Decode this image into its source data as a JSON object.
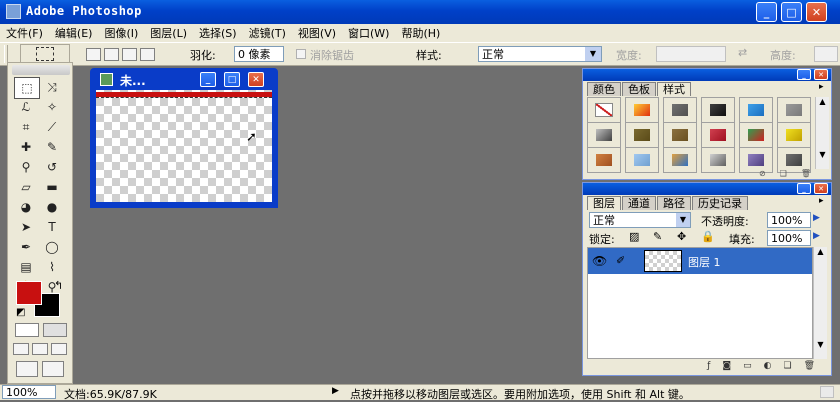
{
  "app": {
    "title": "Adobe Photoshop"
  },
  "menu": [
    "文件(F)",
    "编辑(E)",
    "图像(I)",
    "图层(L)",
    "选择(S)",
    "滤镜(T)",
    "视图(V)",
    "窗口(W)",
    "帮助(H)"
  ],
  "options": {
    "feather_label": "羽化:",
    "feather_value": "0 像素",
    "antialias_label": "消除锯齿",
    "style_label": "样式:",
    "style_value": "正常",
    "width_label": "宽度:",
    "height_label": "高度:"
  },
  "document": {
    "title": "未..."
  },
  "swatches_palette": {
    "tabs": [
      "颜色",
      "色板",
      "样式"
    ],
    "styles": [
      {
        "a": "#ffffff",
        "b": "#cc2222"
      },
      {
        "a": "#ffcc33",
        "b": "#e03010"
      },
      {
        "a": "#707070",
        "b": "#505050"
      },
      {
        "a": "#404040",
        "b": "#101010"
      },
      {
        "a": "#3ea0e8",
        "b": "#1b6fc0"
      },
      {
        "a": "#9a9a9a",
        "b": "#7a7a7a"
      },
      {
        "a": "#c0c0c0",
        "b": "#404040"
      },
      {
        "a": "#7a6a30",
        "b": "#5a4a18"
      },
      {
        "a": "#8a7040",
        "b": "#6a5020"
      },
      {
        "a": "#d04050",
        "b": "#a01020"
      },
      {
        "a": "#30a050",
        "b": "#d02020"
      },
      {
        "a": "#f0e020",
        "b": "#c0a000"
      },
      {
        "a": "#d08040",
        "b": "#a05020"
      },
      {
        "a": "#a0c8f0",
        "b": "#70a0d0"
      },
      {
        "a": "#e0a040",
        "b": "#3070c0"
      },
      {
        "a": "#d0d0d0",
        "b": "#606060"
      },
      {
        "a": "#9080c0",
        "b": "#504080"
      },
      {
        "a": "#707070",
        "b": "#404040"
      }
    ]
  },
  "layers_palette": {
    "tabs": [
      "图层",
      "通道",
      "路径",
      "历史记录"
    ],
    "blend_mode": "正常",
    "opacity_label": "不透明度:",
    "opacity_value": "100%",
    "lock_label": "锁定:",
    "fill_label": "填充:",
    "fill_value": "100%",
    "layers": [
      {
        "name": "图层 1"
      }
    ]
  },
  "status": {
    "zoom": "100%",
    "doc_info": "文档:65.9K/87.9K",
    "hint": "点按并拖移以移动图层或选区。要用附加选项，使用 Shift 和 Alt 键。"
  },
  "colors": {
    "foreground": "#c81010",
    "background": "#000000",
    "title_blue": "#0a3cc8",
    "layer_selected": "#316ac5"
  },
  "tools": [
    "marquee-tool-icon",
    "move-tool-icon",
    "lasso-tool-icon",
    "magic-wand-icon",
    "crop-tool-icon",
    "slice-tool-icon",
    "healing-brush-icon",
    "brush-tool-icon",
    "clone-stamp-icon",
    "history-brush-icon",
    "eraser-tool-icon",
    "gradient-tool-icon",
    "blur-tool-icon",
    "dodge-tool-icon",
    "path-select-icon",
    "type-tool-icon",
    "pen-tool-icon",
    "shape-tool-icon",
    "notes-tool-icon",
    "eyedropper-icon",
    "hand-tool-icon",
    "zoom-tool-icon"
  ]
}
